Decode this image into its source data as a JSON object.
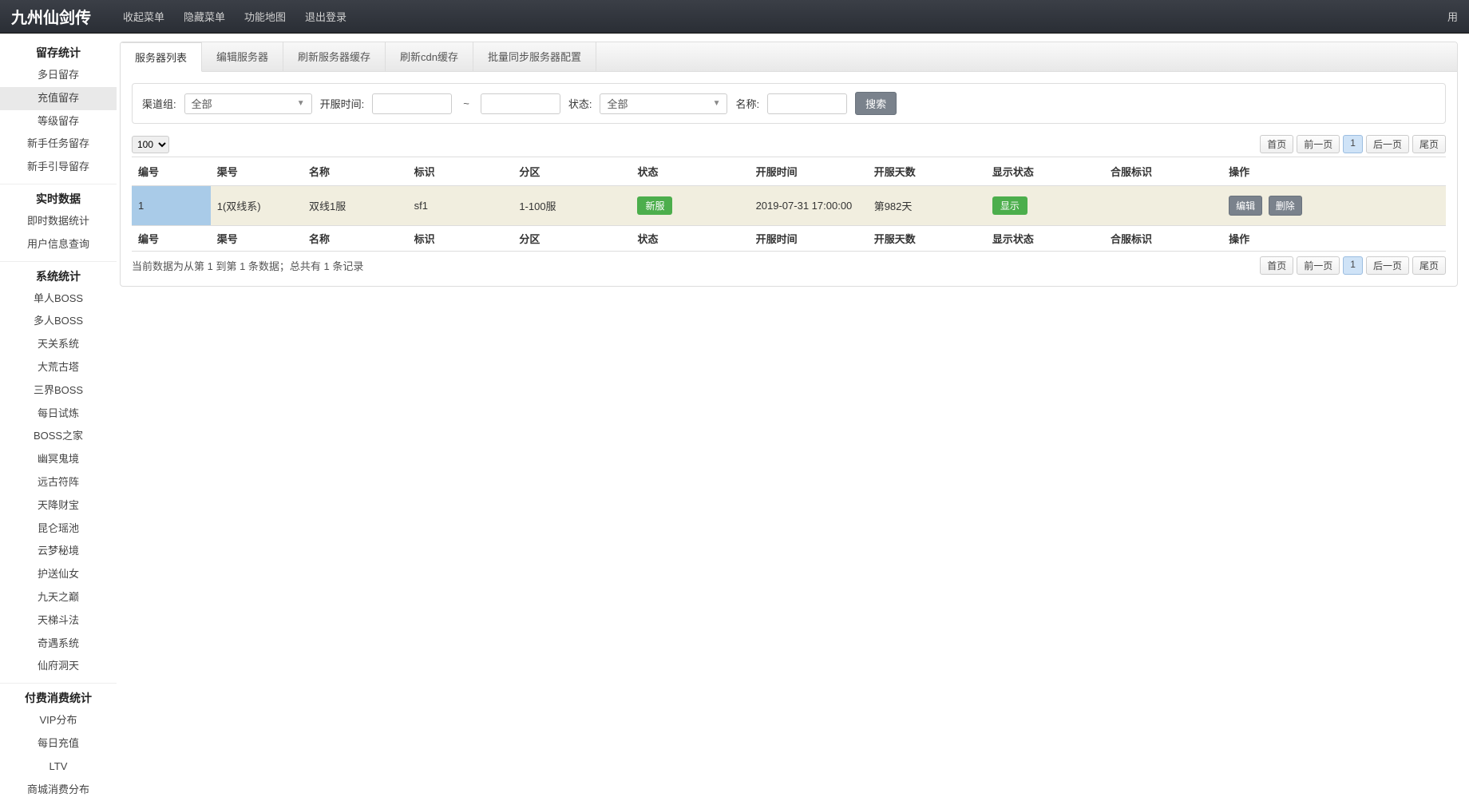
{
  "header": {
    "brand": "九州仙剑传",
    "links": [
      "收起菜单",
      "隐藏菜单",
      "功能地图",
      "退出登录"
    ],
    "right": "用"
  },
  "sidebar": [
    {
      "title": "留存统计",
      "items": [
        "多日留存",
        "充值留存",
        "等级留存",
        "新手任务留存",
        "新手引导留存"
      ],
      "active": "充值留存"
    },
    {
      "title": "实时数据",
      "items": [
        "即时数据统计",
        "用户信息查询"
      ]
    },
    {
      "title": "系统统计",
      "items": [
        "单人BOSS",
        "多人BOSS",
        "天关系统",
        "大荒古塔",
        "三界BOSS",
        "每日试炼",
        "BOSS之家",
        "幽冥鬼境",
        "远古符阵",
        "天降财宝",
        "昆仑瑶池",
        "云梦秘境",
        "护送仙女",
        "九天之巅",
        "天梯斗法",
        "奇遇系统",
        "仙府洞天"
      ]
    },
    {
      "title": "付费消费统计",
      "items": [
        "VIP分布",
        "每日充值",
        "LTV",
        "商城消费分布"
      ]
    }
  ],
  "tabs": [
    "服务器列表",
    "编辑服务器",
    "刷新服务器缓存",
    "刷新cdn缓存",
    "批量同步服务器配置"
  ],
  "active_tab": 0,
  "filters": {
    "channel_label": "渠道组:",
    "channel_value": "全部",
    "opentime_label": "开服时间:",
    "tilde": "~",
    "status_label": "状态:",
    "status_value": "全部",
    "name_label": "名称:",
    "search_btn": "搜索"
  },
  "pagesize_value": "100",
  "pager": {
    "first": "首页",
    "prev": "前一页",
    "page": "1",
    "next": "后一页",
    "last": "尾页"
  },
  "columns": [
    "编号",
    "渠号",
    "名称",
    "标识",
    "分区",
    "状态",
    "开服时间",
    "开服天数",
    "显示状态",
    "合服标识",
    "操作"
  ],
  "row": {
    "id": "1",
    "channel": "1(双线系)",
    "name": "双线1服",
    "flag": "sf1",
    "zone": "1-100服",
    "status": "新服",
    "opentime": "2019-07-31 17:00:00",
    "days": "第982天",
    "display": "显示",
    "merge": "",
    "op_edit": "编辑",
    "op_delete": "删除"
  },
  "footer_summary": "当前数据为从第 1 到第 1 条数据；总共有 1 条记录"
}
